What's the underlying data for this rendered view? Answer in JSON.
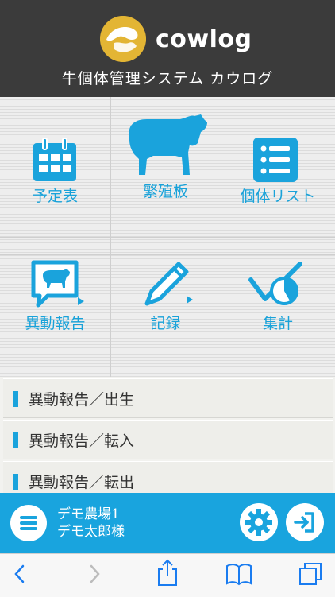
{
  "header": {
    "logo_text": "cowlog",
    "subtitle": "牛個体管理システム カウログ"
  },
  "menu": [
    {
      "label": "予定表",
      "icon": "calendar-icon"
    },
    {
      "label": "繁殖板",
      "icon": "cow-icon"
    },
    {
      "label": "個体リスト",
      "icon": "list-icon"
    },
    {
      "label": "異動報告",
      "icon": "cow-report-icon"
    },
    {
      "label": "記録",
      "icon": "pencil-icon"
    },
    {
      "label": "集計",
      "icon": "check-chart-icon"
    }
  ],
  "reports": [
    {
      "label": "異動報告／出生"
    },
    {
      "label": "異動報告／転入"
    },
    {
      "label": "異動報告／転出"
    }
  ],
  "footer": {
    "farm_name": "デモ農場1",
    "user_name": "デモ太郎様"
  },
  "colors": {
    "accent": "#19a4de",
    "header_bg": "#3b3b3b",
    "logo_yellow": "#e3b534"
  }
}
